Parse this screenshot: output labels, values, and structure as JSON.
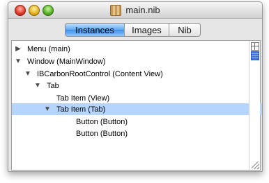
{
  "window": {
    "title": "main.nib",
    "icons": {
      "document": "nib-file-icon",
      "close": "close-traffic-light",
      "minimize": "minimize-traffic-light",
      "zoom": "zoom-traffic-light"
    }
  },
  "tabs": {
    "items": [
      {
        "label": "Instances",
        "selected": true
      },
      {
        "label": "Images",
        "selected": false
      },
      {
        "label": "Nib",
        "selected": false
      }
    ]
  },
  "tree": {
    "rows": [
      {
        "label": "Menu (main)",
        "expanded": false,
        "has_children": true,
        "selected": false
      },
      {
        "label": "Window (MainWindow)",
        "expanded": true,
        "has_children": true,
        "selected": false
      },
      {
        "label": "IBCarbonRootControl (Content View)",
        "expanded": true,
        "has_children": true,
        "selected": false
      },
      {
        "label": "Tab",
        "expanded": true,
        "has_children": true,
        "selected": false
      },
      {
        "label": "Tab Item (View)",
        "expanded": false,
        "has_children": false,
        "selected": false
      },
      {
        "label": "Tab Item (Tab)",
        "expanded": true,
        "has_children": true,
        "selected": true
      },
      {
        "label": "Button (Button)",
        "expanded": false,
        "has_children": false,
        "selected": false
      },
      {
        "label": "Button (Button)",
        "expanded": false,
        "has_children": false,
        "selected": false
      }
    ],
    "triangles": {
      "collapsed": "▶",
      "expanded": "▼"
    }
  },
  "colors": {
    "selection": "#b5d5ff",
    "segment_selected": "#4f9cea"
  }
}
